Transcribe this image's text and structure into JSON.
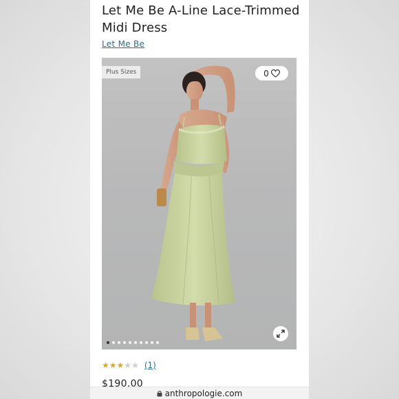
{
  "product": {
    "title": "Let Me Be A-Line Lace-Trimmed Midi Dress",
    "brand": "Let Me Be",
    "price": "$190.00"
  },
  "gallery": {
    "badge": "Plus Sizes",
    "wishlist_count": "0",
    "image_count": 10,
    "active_index": 0
  },
  "rating": {
    "stars": 3,
    "max_stars": 5,
    "review_count": "(1)"
  },
  "browser": {
    "domain": "anthropologie.com"
  },
  "colors": {
    "link": "#2b6f8a",
    "star": "#d9a634",
    "dress": "#c9d3a0"
  },
  "icons": {
    "wishlist": "heart-icon",
    "expand": "expand-icon",
    "url": "lock-icon"
  }
}
